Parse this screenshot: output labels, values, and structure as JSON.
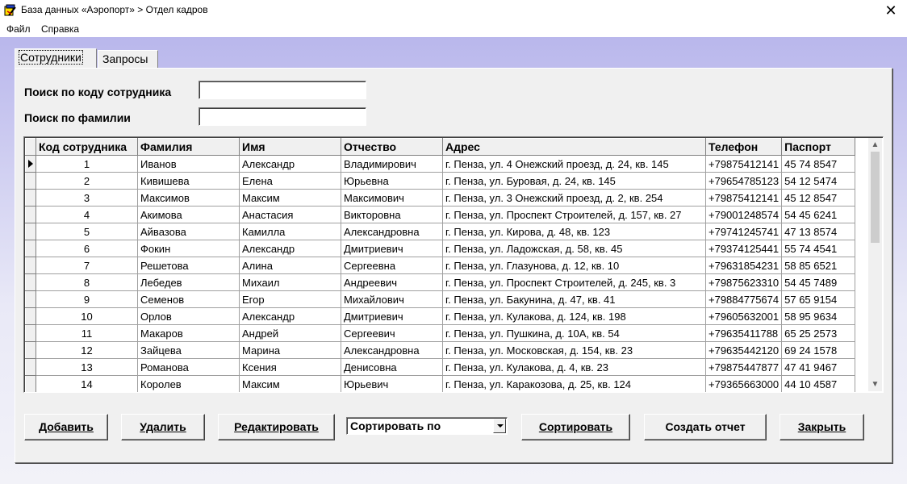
{
  "window": {
    "title": "База данных «Аэропорт» > Отдел кадров",
    "close_glyph": "✕",
    "icon": "app-icon"
  },
  "menu": {
    "items": [
      {
        "label": "Файл"
      },
      {
        "label": "Справка"
      }
    ]
  },
  "tabs": [
    {
      "label": "Сотрудники",
      "active": true
    },
    {
      "label": "Запросы",
      "active": false
    }
  ],
  "search": {
    "by_code_label": "Поиск по коду сотрудника",
    "by_code_value": "",
    "by_surname_label": "Поиск по фамилии",
    "by_surname_value": ""
  },
  "grid": {
    "columns": [
      "Код сотрудника",
      "Фамилия",
      "Имя",
      "Отчество",
      "Адрес",
      "Телефон",
      "Паспорт"
    ],
    "current_row": 0,
    "rows": [
      [
        "1",
        "Иванов",
        "Александр",
        "Владимирович",
        "г. Пенза, ул. 4 Онежский проезд, д. 24, кв. 145",
        "+79875412141",
        "45 74 8547"
      ],
      [
        "2",
        "Кивишева",
        "Елена",
        "Юрьевна",
        "г. Пенза, ул. Буровая, д. 24, кв. 145",
        "+79654785123",
        "54 12 5474"
      ],
      [
        "3",
        "Максимов",
        "Максим",
        "Максимович",
        "г. Пенза, ул. 3 Онежский проезд, д. 2, кв. 254",
        "+79875412141",
        "45 12 8547"
      ],
      [
        "4",
        "Акимова",
        "Анастасия",
        "Викторовна",
        "г. Пенза, ул. Проспект Строителей, д. 157, кв. 27",
        "+79001248574",
        "54 45 6241"
      ],
      [
        "5",
        "Айвазова",
        "Камилла",
        "Александровна",
        "г. Пенза, ул. Кирова, д. 48, кв. 123",
        "+79741245741",
        "47 13 8574"
      ],
      [
        "6",
        "Фокин",
        "Александр",
        "Дмитриевич",
        "г. Пенза, ул. Ладожская, д. 58, кв. 45",
        "+79374125441",
        "55 74 4541"
      ],
      [
        "7",
        "Решетова",
        "Алина",
        "Сергеевна",
        "г. Пенза, ул. Глазунова, д. 12, кв. 10",
        "+79631854231",
        "58 85 6521"
      ],
      [
        "8",
        "Лебедев",
        "Михаил",
        "Андреевич",
        "г. Пенза, ул. Проспект Строителей, д. 245, кв. 3",
        "+79875623310",
        "54 45 7489"
      ],
      [
        "9",
        "Семенов",
        "Егор",
        "Михайлович",
        "г. Пенза, ул. Бакунина, д. 47, кв. 41",
        "+79884775674",
        "57 65 9154"
      ],
      [
        "10",
        "Орлов",
        "Александр",
        "Дмитриевич",
        "г. Пенза, ул. Кулакова, д. 124, кв. 198",
        "+79605632001",
        "58 95 9634"
      ],
      [
        "11",
        "Макаров",
        "Андрей",
        "Сергеевич",
        "г. Пенза, ул. Пушкина, д. 10А, кв. 54",
        "+79635411788",
        "65 25 2573"
      ],
      [
        "12",
        "Зайцева",
        "Марина",
        "Александровна",
        "г. Пенза, ул. Московская, д. 154, кв. 23",
        "+79635442120",
        "69 24 1578"
      ],
      [
        "13",
        "Романова",
        "Ксения",
        "Денисовна",
        "г. Пенза, ул. Кулакова, д. 4, кв. 23",
        "+79875447877",
        "47 41 9467"
      ],
      [
        "14",
        "Королев",
        "Максим",
        "Юрьевич",
        "г. Пенза, ул. Каракозова, д. 25, кв. 124",
        "+79365663000",
        "44 10 4587"
      ]
    ]
  },
  "buttons": {
    "add": "Добавить",
    "delete": "Удалить",
    "edit": "Редактировать",
    "sort": "Сортировать",
    "report": "Создать отчет",
    "close": "Закрыть"
  },
  "sort_combo": {
    "selected": "Сортировать по"
  }
}
